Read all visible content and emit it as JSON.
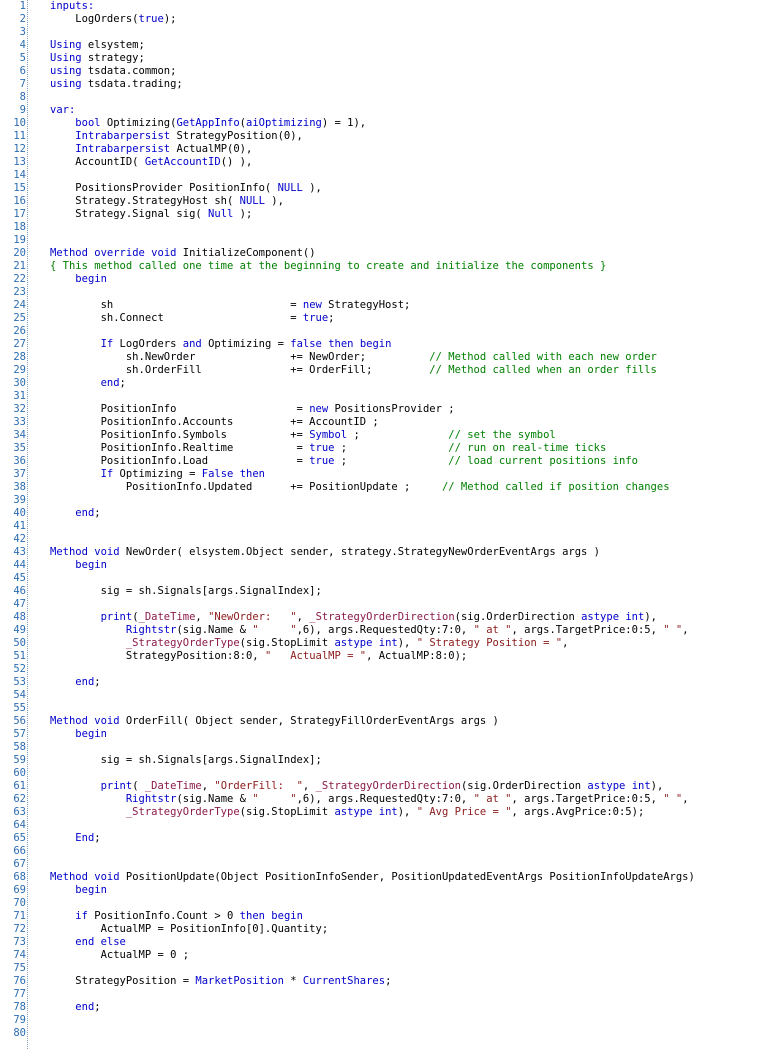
{
  "editor": {
    "colors": {
      "keyword": "#0000cc",
      "string": "#8b1a1a",
      "comment": "#008000",
      "reserved": "#8b1a4a",
      "line_number": "#2b6cb0",
      "text": "#000000"
    },
    "lines": [
      {
        "n": "1",
        "t": [
          [
            "kw",
            "inputs:"
          ]
        ]
      },
      {
        "n": "2",
        "t": [
          [
            "text",
            "    LogOrders("
          ],
          [
            "kw",
            "true"
          ],
          [
            "text",
            ");"
          ]
        ]
      },
      {
        "n": "3",
        "t": []
      },
      {
        "n": "4",
        "t": [
          [
            "kw",
            "Using"
          ],
          [
            "text",
            " elsystem;"
          ]
        ]
      },
      {
        "n": "5",
        "t": [
          [
            "kw",
            "Using"
          ],
          [
            "text",
            " strategy;"
          ]
        ]
      },
      {
        "n": "6",
        "t": [
          [
            "kw",
            "using"
          ],
          [
            "text",
            " tsdata.common;"
          ]
        ]
      },
      {
        "n": "7",
        "t": [
          [
            "kw",
            "using"
          ],
          [
            "text",
            " tsdata.trading;"
          ]
        ]
      },
      {
        "n": "8",
        "t": []
      },
      {
        "n": "9",
        "t": [
          [
            "kw",
            "var:"
          ]
        ]
      },
      {
        "n": "10",
        "t": [
          [
            "text",
            "    "
          ],
          [
            "kw",
            "bool"
          ],
          [
            "text",
            " Optimizing("
          ],
          [
            "kw",
            "GetAppInfo"
          ],
          [
            "text",
            "("
          ],
          [
            "kw",
            "aiOptimizing"
          ],
          [
            "text",
            ") = 1),"
          ]
        ]
      },
      {
        "n": "11",
        "t": [
          [
            "text",
            "    "
          ],
          [
            "kw",
            "Intrabarpersist"
          ],
          [
            "text",
            " StrategyPosition(0),"
          ]
        ]
      },
      {
        "n": "12",
        "t": [
          [
            "text",
            "    "
          ],
          [
            "kw",
            "Intrabarpersist"
          ],
          [
            "text",
            " ActualMP(0),"
          ]
        ]
      },
      {
        "n": "13",
        "t": [
          [
            "text",
            "    AccountID( "
          ],
          [
            "kw",
            "GetAccountID"
          ],
          [
            "text",
            "() ),"
          ]
        ]
      },
      {
        "n": "14",
        "t": []
      },
      {
        "n": "15",
        "t": [
          [
            "text",
            "    PositionsProvider PositionInfo( "
          ],
          [
            "kw",
            "NULL"
          ],
          [
            "text",
            " ),"
          ]
        ]
      },
      {
        "n": "16",
        "t": [
          [
            "text",
            "    Strategy.StrategyHost sh( "
          ],
          [
            "kw",
            "NULL"
          ],
          [
            "text",
            " ),"
          ]
        ]
      },
      {
        "n": "17",
        "t": [
          [
            "text",
            "    Strategy.Signal sig( "
          ],
          [
            "kw",
            "Null"
          ],
          [
            "text",
            " );"
          ]
        ]
      },
      {
        "n": "18",
        "t": []
      },
      {
        "n": "19",
        "t": []
      },
      {
        "n": "20",
        "t": [
          [
            "kw",
            "Method"
          ],
          [
            "text",
            " "
          ],
          [
            "kw",
            "override"
          ],
          [
            "text",
            " "
          ],
          [
            "kw",
            "void"
          ],
          [
            "text",
            " InitializeComponent()"
          ]
        ]
      },
      {
        "n": "21",
        "t": [
          [
            "cmt",
            "{ This method called one time at the beginning to create and initialize the components }"
          ]
        ]
      },
      {
        "n": "22",
        "t": [
          [
            "text",
            "    "
          ],
          [
            "kw",
            "begin"
          ]
        ]
      },
      {
        "n": "23",
        "t": []
      },
      {
        "n": "24",
        "t": [
          [
            "text",
            "        sh                            = "
          ],
          [
            "kw",
            "new"
          ],
          [
            "text",
            " StrategyHost;"
          ]
        ]
      },
      {
        "n": "25",
        "t": [
          [
            "text",
            "        sh.Connect                    = "
          ],
          [
            "kw",
            "true"
          ],
          [
            "text",
            ";"
          ]
        ]
      },
      {
        "n": "26",
        "t": []
      },
      {
        "n": "27",
        "t": [
          [
            "text",
            "        "
          ],
          [
            "kw",
            "If"
          ],
          [
            "text",
            " LogOrders "
          ],
          [
            "kw",
            "and"
          ],
          [
            "text",
            " Optimizing = "
          ],
          [
            "kw",
            "false"
          ],
          [
            "text",
            " "
          ],
          [
            "kw",
            "then"
          ],
          [
            "text",
            " "
          ],
          [
            "kw",
            "begin"
          ]
        ]
      },
      {
        "n": "28",
        "t": [
          [
            "text",
            "            sh.NewOrder               += NewOrder;          "
          ],
          [
            "cmt",
            "// Method called with each new order"
          ]
        ]
      },
      {
        "n": "29",
        "t": [
          [
            "text",
            "            sh.OrderFill              += OrderFill;         "
          ],
          [
            "cmt",
            "// Method called when an order fills"
          ]
        ]
      },
      {
        "n": "30",
        "t": [
          [
            "text",
            "        "
          ],
          [
            "kw",
            "end"
          ],
          [
            "text",
            ";"
          ]
        ]
      },
      {
        "n": "31",
        "t": []
      },
      {
        "n": "32",
        "t": [
          [
            "text",
            "        PositionInfo                   = "
          ],
          [
            "kw",
            "new"
          ],
          [
            "text",
            " PositionsProvider ;"
          ]
        ]
      },
      {
        "n": "33",
        "t": [
          [
            "text",
            "        PositionInfo.Accounts         += AccountID ;"
          ]
        ]
      },
      {
        "n": "34",
        "t": [
          [
            "text",
            "        PositionInfo.Symbols          += "
          ],
          [
            "kw",
            "Symbol"
          ],
          [
            "text",
            " ;              "
          ],
          [
            "cmt",
            "// set the symbol"
          ]
        ]
      },
      {
        "n": "35",
        "t": [
          [
            "text",
            "        PositionInfo.Realtime          = "
          ],
          [
            "kw",
            "true"
          ],
          [
            "text",
            " ;                "
          ],
          [
            "cmt",
            "// run on real-time ticks"
          ]
        ]
      },
      {
        "n": "36",
        "t": [
          [
            "text",
            "        PositionInfo.Load              = "
          ],
          [
            "kw",
            "true"
          ],
          [
            "text",
            " ;                "
          ],
          [
            "cmt",
            "// load current positions info"
          ]
        ]
      },
      {
        "n": "37",
        "t": [
          [
            "text",
            "        "
          ],
          [
            "kw",
            "If"
          ],
          [
            "text",
            " Optimizing = "
          ],
          [
            "kw",
            "False"
          ],
          [
            "text",
            " "
          ],
          [
            "kw",
            "then"
          ]
        ]
      },
      {
        "n": "38",
        "t": [
          [
            "text",
            "            PositionInfo.Updated      += PositionUpdate ;     "
          ],
          [
            "cmt",
            "// Method called if position changes"
          ]
        ]
      },
      {
        "n": "39",
        "t": []
      },
      {
        "n": "40",
        "t": [
          [
            "text",
            "    "
          ],
          [
            "kw",
            "end"
          ],
          [
            "text",
            ";"
          ]
        ]
      },
      {
        "n": "41",
        "t": []
      },
      {
        "n": "42",
        "t": []
      },
      {
        "n": "43",
        "t": [
          [
            "kw",
            "Method"
          ],
          [
            "text",
            " "
          ],
          [
            "kw",
            "void"
          ],
          [
            "text",
            " NewOrder( elsystem.Object sender, strategy.StrategyNewOrderEventArgs args )"
          ]
        ]
      },
      {
        "n": "44",
        "t": [
          [
            "text",
            "    "
          ],
          [
            "kw",
            "begin"
          ]
        ]
      },
      {
        "n": "45",
        "t": []
      },
      {
        "n": "46",
        "t": [
          [
            "text",
            "        sig = sh.Signals[args.SignalIndex];"
          ]
        ]
      },
      {
        "n": "47",
        "t": []
      },
      {
        "n": "48",
        "t": [
          [
            "text",
            "        "
          ],
          [
            "kw",
            "print"
          ],
          [
            "text",
            "("
          ],
          [
            "res",
            "_DateTime"
          ],
          [
            "text",
            ", "
          ],
          [
            "str",
            "\"NewOrder:   \""
          ],
          [
            "text",
            ", "
          ],
          [
            "res",
            "_StrategyOrderDirection"
          ],
          [
            "text",
            "(sig.OrderDirection "
          ],
          [
            "kw",
            "astype"
          ],
          [
            "text",
            " "
          ],
          [
            "kw",
            "int"
          ],
          [
            "text",
            "),"
          ]
        ]
      },
      {
        "n": "49",
        "t": [
          [
            "text",
            "            "
          ],
          [
            "kw",
            "Rightstr"
          ],
          [
            "text",
            "(sig.Name & "
          ],
          [
            "str",
            "\"     \""
          ],
          [
            "text",
            ",6), args.RequestedQty:7:0, "
          ],
          [
            "str",
            "\" at \""
          ],
          [
            "text",
            ", args.TargetPrice:0:5, "
          ],
          [
            "str",
            "\" \""
          ],
          [
            "text",
            ","
          ]
        ]
      },
      {
        "n": "50",
        "t": [
          [
            "text",
            "            "
          ],
          [
            "res",
            "_StrategyOrderType"
          ],
          [
            "text",
            "(sig.StopLimit "
          ],
          [
            "kw",
            "astype"
          ],
          [
            "text",
            " "
          ],
          [
            "kw",
            "int"
          ],
          [
            "text",
            "), "
          ],
          [
            "str",
            "\" Strategy Position = \""
          ],
          [
            "text",
            ","
          ]
        ]
      },
      {
        "n": "51",
        "t": [
          [
            "text",
            "            StrategyPosition:8:0, "
          ],
          [
            "str",
            "\"   ActualMP = \""
          ],
          [
            "text",
            ", ActualMP:8:0);"
          ]
        ]
      },
      {
        "n": "52",
        "t": []
      },
      {
        "n": "53",
        "t": [
          [
            "text",
            "    "
          ],
          [
            "kw",
            "end"
          ],
          [
            "text",
            ";"
          ]
        ]
      },
      {
        "n": "54",
        "t": []
      },
      {
        "n": "55",
        "t": []
      },
      {
        "n": "56",
        "t": [
          [
            "kw",
            "Method"
          ],
          [
            "text",
            " "
          ],
          [
            "kw",
            "void"
          ],
          [
            "text",
            " OrderFill( Object sender, StrategyFillOrderEventArgs args )"
          ]
        ]
      },
      {
        "n": "57",
        "t": [
          [
            "text",
            "    "
          ],
          [
            "kw",
            "begin"
          ]
        ]
      },
      {
        "n": "58",
        "t": []
      },
      {
        "n": "59",
        "t": [
          [
            "text",
            "        sig = sh.Signals[args.SignalIndex];"
          ]
        ]
      },
      {
        "n": "60",
        "t": []
      },
      {
        "n": "61",
        "t": [
          [
            "text",
            "        "
          ],
          [
            "kw",
            "print"
          ],
          [
            "text",
            "( "
          ],
          [
            "res",
            "_DateTime"
          ],
          [
            "text",
            ", "
          ],
          [
            "str",
            "\"OrderFill:  \""
          ],
          [
            "text",
            ", "
          ],
          [
            "res",
            "_StrategyOrderDirection"
          ],
          [
            "text",
            "(sig.OrderDirection "
          ],
          [
            "kw",
            "astype"
          ],
          [
            "text",
            " "
          ],
          [
            "kw",
            "int"
          ],
          [
            "text",
            "),"
          ]
        ]
      },
      {
        "n": "62",
        "t": [
          [
            "text",
            "            "
          ],
          [
            "kw",
            "Rightstr"
          ],
          [
            "text",
            "(sig.Name & "
          ],
          [
            "str",
            "\"     \""
          ],
          [
            "text",
            ",6), args.RequestedQty:7:0, "
          ],
          [
            "str",
            "\" at \""
          ],
          [
            "text",
            ", args.TargetPrice:0:5, "
          ],
          [
            "str",
            "\" \""
          ],
          [
            "text",
            ","
          ]
        ]
      },
      {
        "n": "63",
        "t": [
          [
            "text",
            "            "
          ],
          [
            "res",
            "_StrategyOrderType"
          ],
          [
            "text",
            "(sig.StopLimit "
          ],
          [
            "kw",
            "astype"
          ],
          [
            "text",
            " "
          ],
          [
            "kw",
            "int"
          ],
          [
            "text",
            "), "
          ],
          [
            "str",
            "\" Avg Price = \""
          ],
          [
            "text",
            ", args.AvgPrice:0:5);"
          ]
        ]
      },
      {
        "n": "64",
        "t": []
      },
      {
        "n": "65",
        "t": [
          [
            "text",
            "    "
          ],
          [
            "kw",
            "End"
          ],
          [
            "text",
            ";"
          ]
        ]
      },
      {
        "n": "66",
        "t": []
      },
      {
        "n": "67",
        "t": []
      },
      {
        "n": "68",
        "t": [
          [
            "kw",
            "Method"
          ],
          [
            "text",
            " "
          ],
          [
            "kw",
            "void"
          ],
          [
            "text",
            " PositionUpdate(Object PositionInfoSender, PositionUpdatedEventArgs PositionInfoUpdateArgs)"
          ]
        ]
      },
      {
        "n": "69",
        "t": [
          [
            "text",
            "    "
          ],
          [
            "kw",
            "begin"
          ]
        ]
      },
      {
        "n": "70",
        "t": []
      },
      {
        "n": "71",
        "t": [
          [
            "text",
            "    "
          ],
          [
            "kw",
            "if"
          ],
          [
            "text",
            " PositionInfo.Count > 0 "
          ],
          [
            "kw",
            "then"
          ],
          [
            "text",
            " "
          ],
          [
            "kw",
            "begin"
          ]
        ]
      },
      {
        "n": "72",
        "t": [
          [
            "text",
            "        ActualMP = PositionInfo[0].Quantity;"
          ]
        ]
      },
      {
        "n": "73",
        "t": [
          [
            "text",
            "    "
          ],
          [
            "kw",
            "end"
          ],
          [
            "text",
            " "
          ],
          [
            "kw",
            "else"
          ]
        ]
      },
      {
        "n": "74",
        "t": [
          [
            "text",
            "        ActualMP = 0 ;"
          ]
        ]
      },
      {
        "n": "75",
        "t": []
      },
      {
        "n": "76",
        "t": [
          [
            "text",
            "    StrategyPosition = "
          ],
          [
            "kw",
            "MarketPosition"
          ],
          [
            "text",
            " * "
          ],
          [
            "kw",
            "CurrentShares"
          ],
          [
            "text",
            ";"
          ]
        ]
      },
      {
        "n": "77",
        "t": []
      },
      {
        "n": "78",
        "t": [
          [
            "text",
            "    "
          ],
          [
            "kw",
            "end"
          ],
          [
            "text",
            ";"
          ]
        ]
      },
      {
        "n": "79",
        "t": []
      },
      {
        "n": "80",
        "t": []
      }
    ]
  }
}
